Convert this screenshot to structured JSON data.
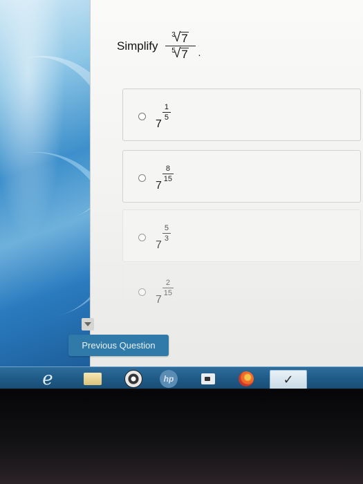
{
  "question": {
    "label": "Simplify",
    "numerator": {
      "index": "3",
      "radicand": "7"
    },
    "denominator": {
      "index": "5",
      "radicand": "7"
    },
    "terminator": "."
  },
  "options": [
    {
      "base": "7",
      "exp_num": "1",
      "exp_den": "5"
    },
    {
      "base": "7",
      "exp_num": "8",
      "exp_den": "15"
    },
    {
      "base": "7",
      "exp_num": "5",
      "exp_den": "3"
    },
    {
      "base": "7",
      "exp_num": "2",
      "exp_den": "15"
    }
  ],
  "footer": {
    "previous_label": "Previous Question"
  },
  "taskbar": {
    "hp_label": "hp",
    "start_glyph": "e",
    "active_glyph": "✓"
  },
  "colors": {
    "button": "#2f7aa8",
    "taskbar": "#1f5a86"
  }
}
